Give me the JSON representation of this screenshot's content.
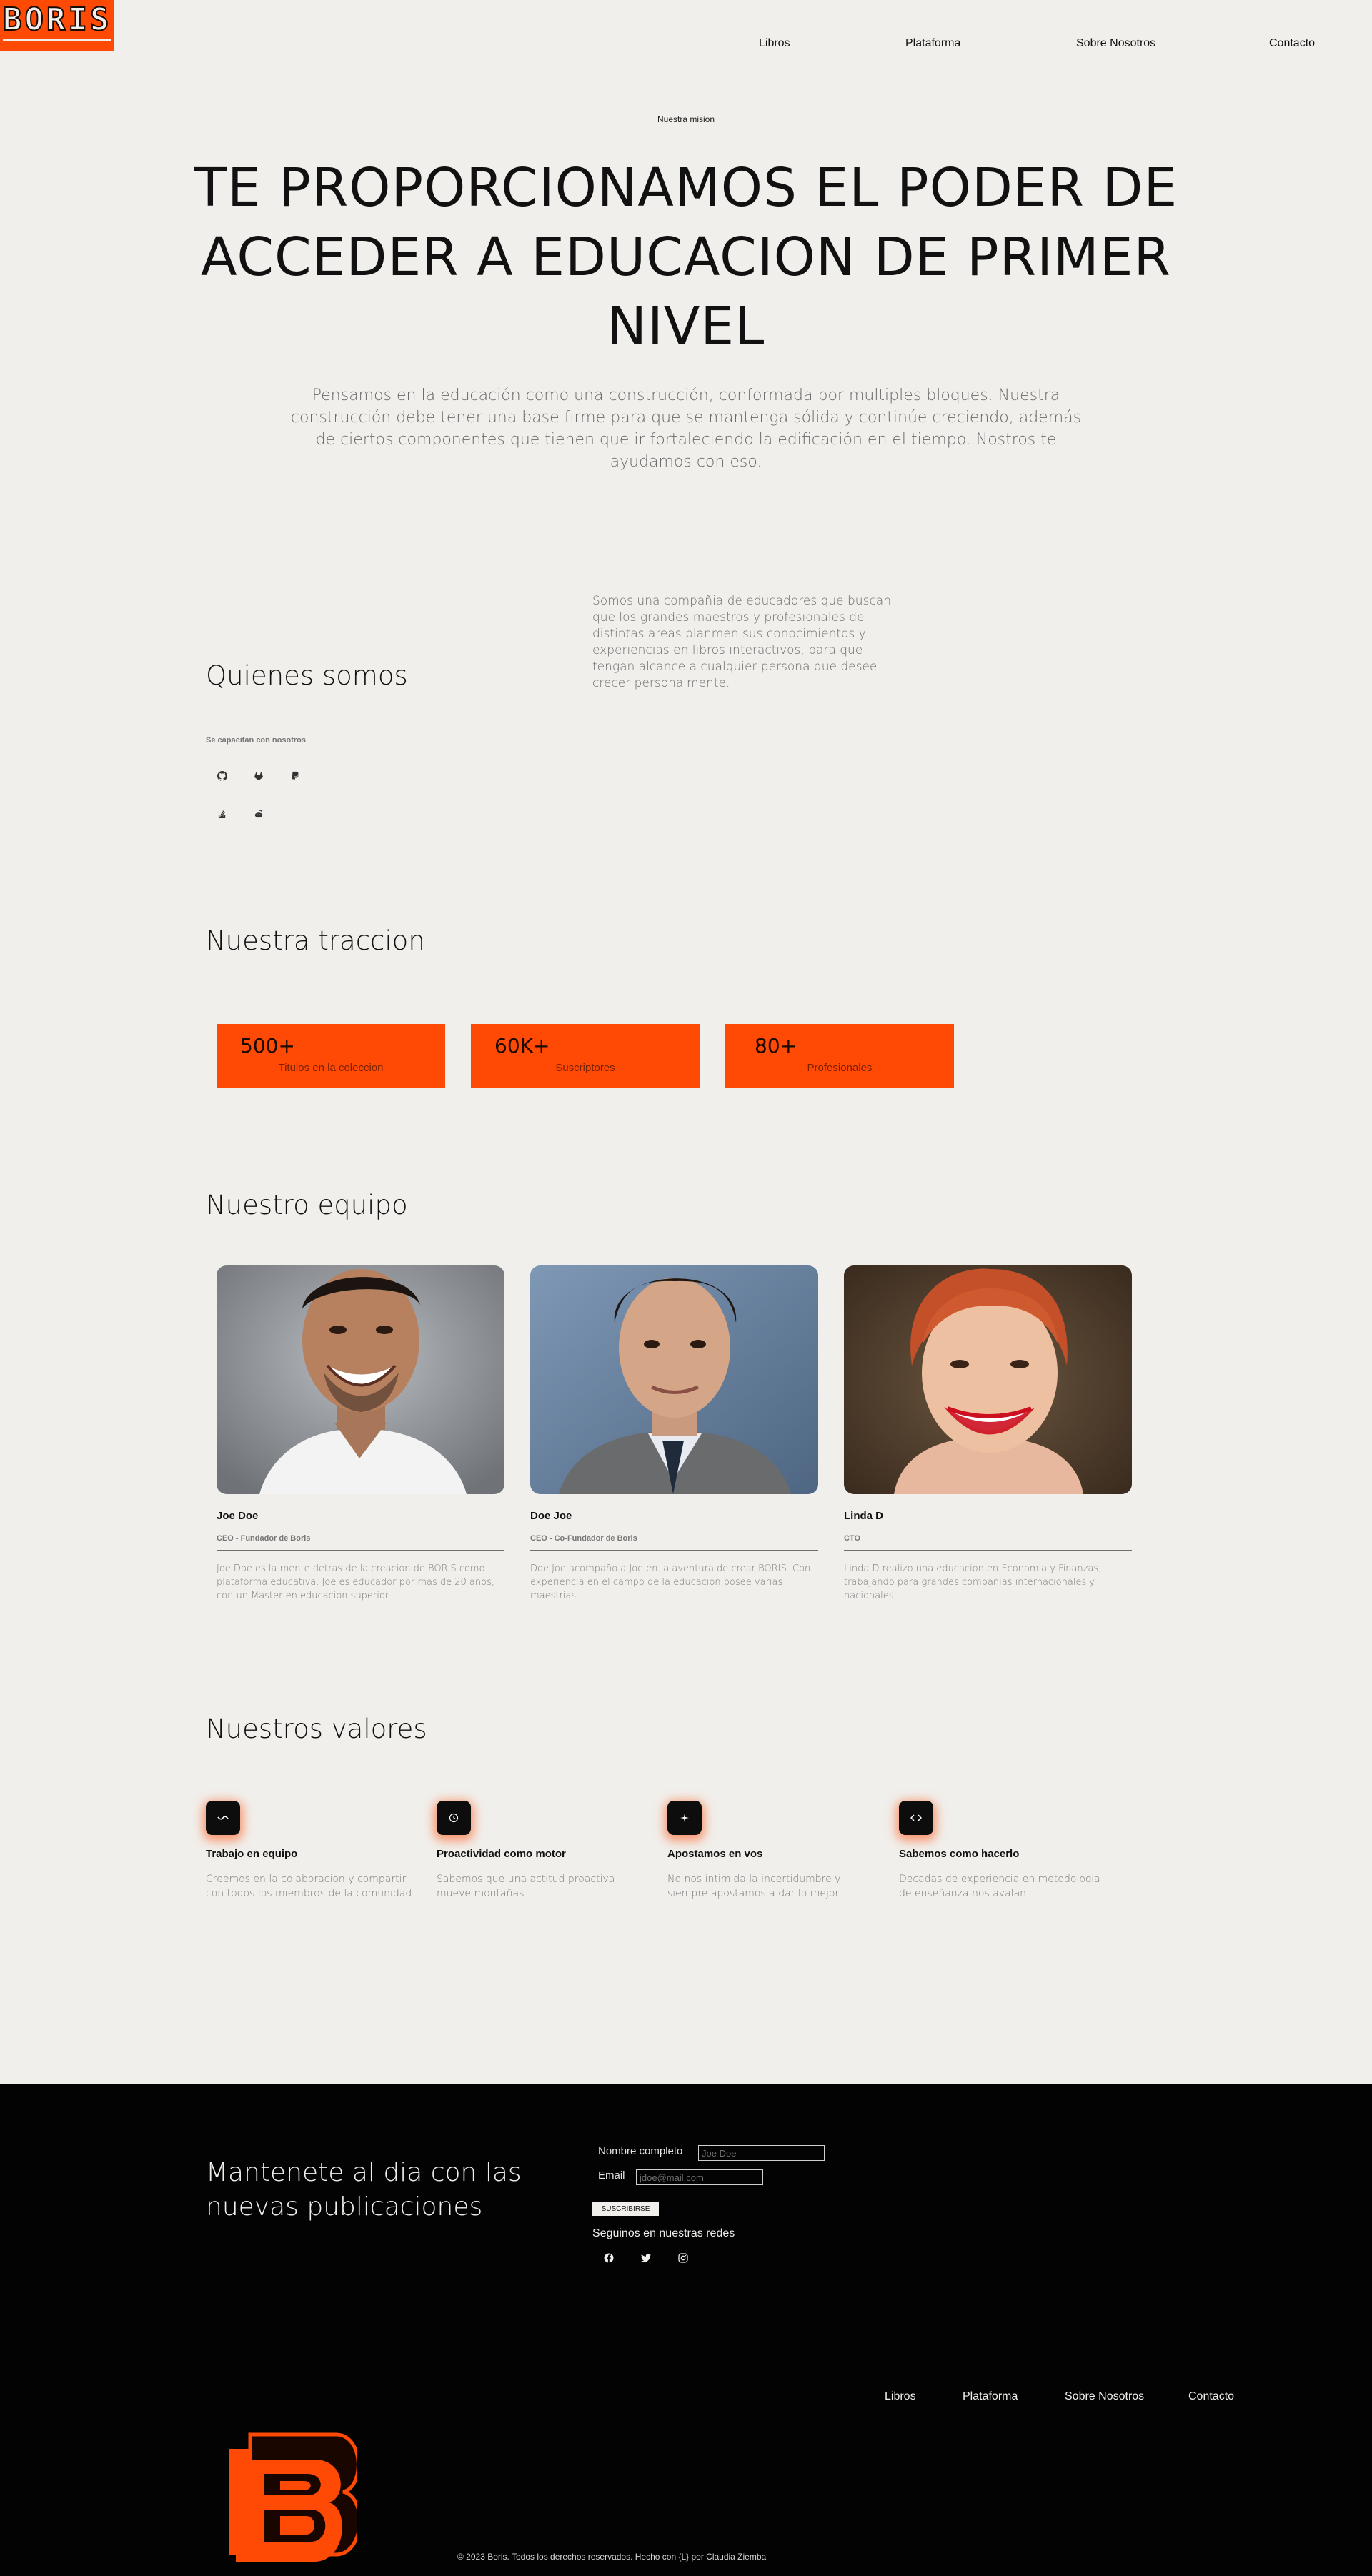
{
  "brand": {
    "logo_text": "BORIS",
    "accent_color": "#ff4a05",
    "dark_color": "#030303",
    "background_color": "#f1efeb"
  },
  "nav": {
    "items": [
      "Libros",
      "Plataforma",
      "Sobre Nosotros",
      "Contacto"
    ]
  },
  "hero": {
    "eyebrow": "Nuestra mision",
    "title": "TE PROPORCIONAMOS EL PODER DE ACCEDER A EDUCACION DE PRIMER NIVEL",
    "subtitle": "Pensamos en la educación como una construcción, conformada por multiples bloques. Nuestra construcción debe tener una base firme para que se mantenga sólida y continúe creciendo, además de ciertos componentes que tienen que ir fortaleciendo la edificación en el tiempo. Nostros te ayudamos con eso."
  },
  "about": {
    "title": "Quienes somos",
    "text": "Somos una compañia de educadores que buscan que los grandes maestros y profesionales de distintas areas planmen sus conocimientos y experiencias en libros interactivos, para que tengan alcance a cualquier persona que desee crecer personalmente.",
    "partners_label": "Se capacitan con nosotros",
    "partner_icons": [
      "github-icon",
      "gitlab-icon",
      "paypal-icon",
      "stack-overflow-icon",
      "reddit-icon"
    ]
  },
  "traction": {
    "title": "Nuestra traccion",
    "stats": [
      {
        "value": "500+",
        "label": "Titulos en la coleccion"
      },
      {
        "value": "60K+",
        "label": "Suscriptores"
      },
      {
        "value": "80+",
        "label": "Profesionales"
      }
    ]
  },
  "team": {
    "title": "Nuestro equipo",
    "members": [
      {
        "name": "Joe Doe",
        "role": "CEO - Fundador de Boris",
        "bio": "Joe Doe es la mente detras de la creacion de BORIS como plataforma educativa. Joe es educador por mas de 20 años, con un Master en educacion superior."
      },
      {
        "name": "Doe Joe",
        "role": "CEO - Co-Fundador de Boris",
        "bio": "Doe Joe acompaño a Joe en la aventura de crear BORIS. Con experiencia en el campo de la educacion posee varias maestrias."
      },
      {
        "name": "Linda D",
        "role": "CTO",
        "bio": "Linda D realizo una educacion en Economia y Finanzas, trabajando para grandes compañias internacionales y nacionales."
      }
    ]
  },
  "values": {
    "title": "Nuestros valores",
    "items": [
      {
        "icon": "wave-icon",
        "title": "Trabajo en equipo",
        "desc": "Creemos en la colaboracion y compartir con todos los miembros de la comunidad."
      },
      {
        "icon": "clock-icon",
        "title": "Proactividad como motor",
        "desc": "Sabemos que una actitud proactiva mueve montañas."
      },
      {
        "icon": "sparkle-icon",
        "title": "Apostamos en vos",
        "desc": "No nos intimida la incertidumbre y siempre apostamos a dar lo mejor."
      },
      {
        "icon": "code-icon",
        "title": "Sabemos como hacerlo",
        "desc": "Decadas de experiencia en metodologia de enseñanza nos avalan."
      }
    ]
  },
  "newsletter": {
    "title": "Mantenete al dia con las nuevas publicaciones",
    "name_label": "Nombre completo",
    "name_placeholder": "Joe Doe",
    "email_label": "Email",
    "email_placeholder": "jdoe@mail.com",
    "button": "SUSCRIBIRSE",
    "social_title": "Seguinos en nuestras redes",
    "social_icons": [
      "facebook-icon",
      "twitter-icon",
      "instagram-icon"
    ]
  },
  "footer": {
    "nav": [
      "Libros",
      "Plataforma",
      "Sobre Nosotros",
      "Contacto"
    ],
    "copyright": "© 2023 Boris. Todos los derechos reservados. Hecho con {L} por Claudia Ziemba"
  }
}
